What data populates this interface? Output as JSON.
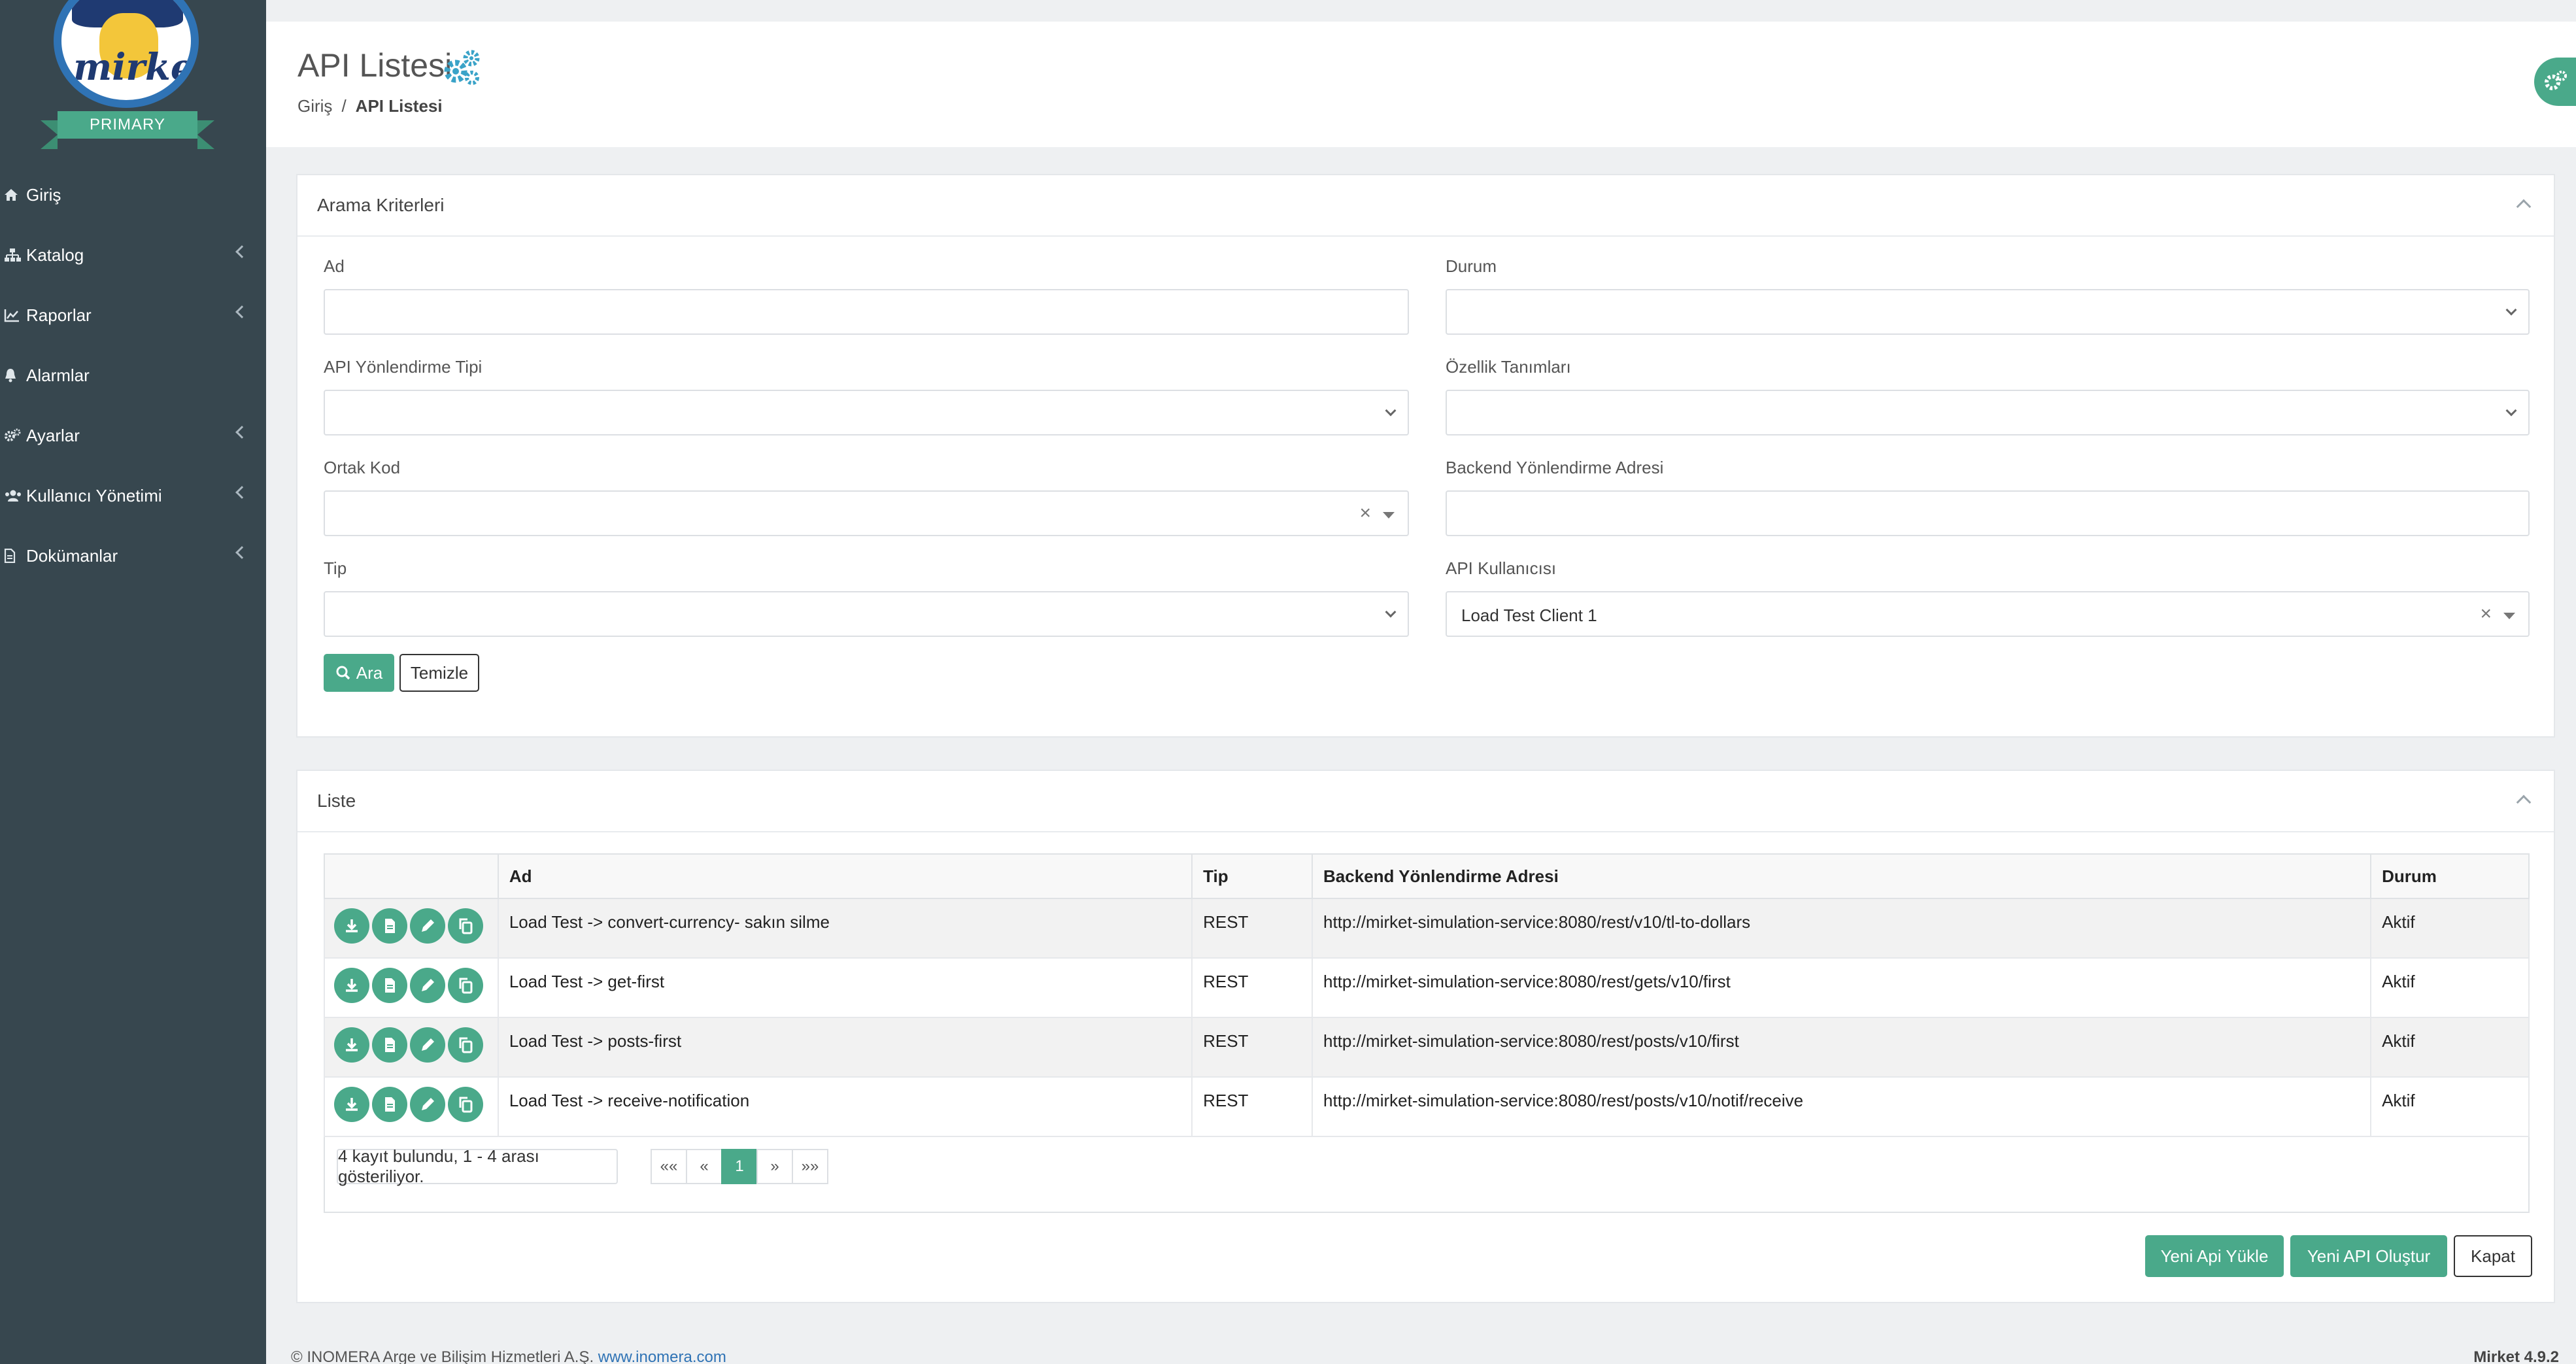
{
  "brand": {
    "logo_text": "mirket",
    "ribbon": "PRIMARY"
  },
  "sidebar": {
    "items": [
      {
        "label": "Giriş",
        "icon": "home-icon",
        "has_children": false
      },
      {
        "label": "Katalog",
        "icon": "sitemap-icon",
        "has_children": true
      },
      {
        "label": "Raporlar",
        "icon": "chart-icon",
        "has_children": true
      },
      {
        "label": "Alarmlar",
        "icon": "bell-icon",
        "has_children": false
      },
      {
        "label": "Ayarlar",
        "icon": "cogs-icon",
        "has_children": true
      },
      {
        "label": "Kullanıcı Yönetimi",
        "icon": "users-icon",
        "has_children": true
      },
      {
        "label": "Dokümanlar",
        "icon": "document-icon",
        "has_children": true
      }
    ]
  },
  "header": {
    "title": "API Listesi",
    "breadcrumb": {
      "home": "Giriş",
      "separator": "/",
      "current": "API Listesi"
    }
  },
  "search": {
    "title": "Arama Kriterleri",
    "fields": {
      "ad": {
        "label": "Ad",
        "value": ""
      },
      "durum": {
        "label": "Durum",
        "value": ""
      },
      "yonlendirme_tipi": {
        "label": "API Yönlendirme Tipi",
        "value": ""
      },
      "ozellik": {
        "label": "Özellik Tanımları",
        "value": ""
      },
      "ortak_kod": {
        "label": "Ortak Kod",
        "value": ""
      },
      "backend_adres": {
        "label": "Backend Yönlendirme Adresi",
        "value": ""
      },
      "tip": {
        "label": "Tip",
        "value": ""
      },
      "api_kullanici": {
        "label": "API Kullanıcısı",
        "value": "Load Test Client 1"
      }
    },
    "clear_symbol": "×",
    "search_button": "Ara",
    "clear_button": "Temizle"
  },
  "list": {
    "title": "Liste",
    "columns": [
      "",
      "Ad",
      "Tip",
      "Backend Yönlendirme Adresi",
      "Durum"
    ],
    "rows": [
      {
        "ad": "Load Test -> convert-currency- sakın silme",
        "tip": "REST",
        "adres": "http://mirket-simulation-service:8080/rest/v10/tl-to-dollars",
        "durum": "Aktif"
      },
      {
        "ad": "Load Test -> get-first",
        "tip": "REST",
        "adres": "http://mirket-simulation-service:8080/rest/gets/v10/first",
        "durum": "Aktif"
      },
      {
        "ad": "Load Test -> posts-first",
        "tip": "REST",
        "adres": "http://mirket-simulation-service:8080/rest/posts/v10/first",
        "durum": "Aktif"
      },
      {
        "ad": "Load Test -> receive-notification",
        "tip": "REST",
        "adres": "http://mirket-simulation-service:8080/rest/posts/v10/notif/receive",
        "durum": "Aktif"
      }
    ],
    "pager_info": "4 kayıt bulundu, 1 - 4 arası gösteriliyor.",
    "pager": {
      "first": "««",
      "prev": "«",
      "current": "1",
      "next": "»",
      "last": "»»"
    }
  },
  "actions": {
    "upload": "Yeni Api Yükle",
    "create": "Yeni API Oluştur",
    "close": "Kapat"
  },
  "footer": {
    "text": "© INOMERA Arge ve Bilişim Hizmetleri A.Ş.",
    "link": "www.inomera.com",
    "version": "Mirket 4.9.2"
  },
  "colors": {
    "sidebar": "#37474f",
    "accent": "#4aa98a",
    "link": "#2f73b5"
  }
}
